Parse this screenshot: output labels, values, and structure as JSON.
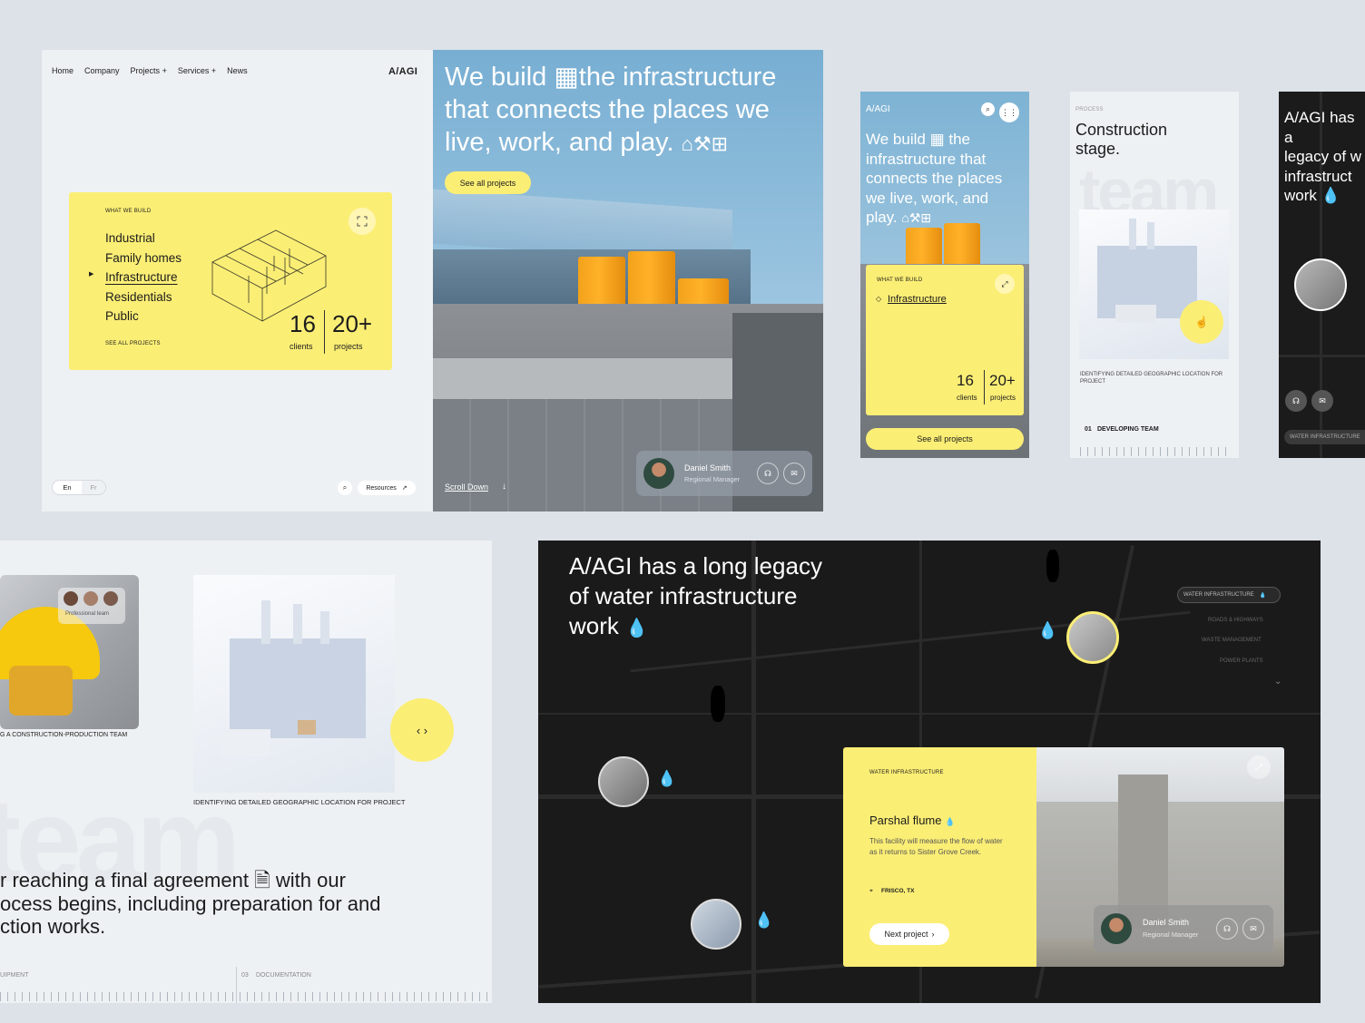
{
  "panelA": {
    "nav": [
      "Home",
      "Company",
      "Projects",
      "Services",
      "News"
    ],
    "plus_icon": "plus-icon",
    "logo": "A/AGI",
    "card": {
      "eyebrow": "WHAT WE BUILD",
      "items": [
        "Industrial",
        "Family homes",
        "Infrastructure",
        "Residentials",
        "Public"
      ],
      "active": "Infrastructure",
      "see_all": "SEE ALL PROJECTS",
      "stats": [
        {
          "value": "16",
          "label": "clients"
        },
        {
          "value": "20+",
          "label": "projects"
        }
      ]
    },
    "lang": [
      "En",
      "Fr"
    ],
    "resources": "Resources"
  },
  "panelB": {
    "hero_l1": "We build",
    "hero_l1b": "the infrastructure",
    "hero_l2": "that connects the places we",
    "hero_l3": "live, work, and play.",
    "cta": "See all projects",
    "scroll": "Scroll Down",
    "contact": {
      "name": "Daniel Smith",
      "role": "Regional Manager"
    }
  },
  "mobile1": {
    "logo": "A/AGI",
    "hero_a": "We build",
    "hero_b": "the",
    "hero_c": "infrastructure that",
    "hero_d": "connects the places",
    "hero_e": "we live, work, and",
    "hero_f": "play.",
    "eyebrow": "WHAT WE BUILD",
    "item": "Infrastructure",
    "stats": [
      {
        "value": "16",
        "label": "clients"
      },
      {
        "value": "20+",
        "label": "projects"
      }
    ],
    "cta": "See all projects"
  },
  "mobile2": {
    "eyebrow": "PROCESS",
    "title_1": "Construction",
    "title_2": "stage.",
    "bg_word": "team",
    "caption": "IDENTIFYING DETAILED GEOGRAPHIC LOCATION FOR PROJECT",
    "step_no": "01",
    "step": "DEVELOPING TEAM"
  },
  "mobile3": {
    "h1": "A/AGI has a",
    "h2": "legacy of w",
    "h3": "infrastruct",
    "h4": "work",
    "tag": "WATER INFRASTRUCTURE"
  },
  "panelF": {
    "team_badge": "Professional team",
    "caption_left": "G A CONSTRUCTION-PRODUCTION TEAM",
    "caption_right": "IDENTIFYING DETAILED  GEOGRAPHIC LOCATION FOR  PROJECT",
    "bg_word": "team",
    "para_1a": "r reaching a final agreement",
    "para_1b": "with our",
    "para_2": "ocess begins, including preparation for and",
    "para_3": "ction works.",
    "step_a": "UIPMENT",
    "step_b_no": "03",
    "step_b": "DOCUMENTATION"
  },
  "panelG": {
    "h1": "A/AGI has a long legacy",
    "h2": "of water infrastructure",
    "h3": "work",
    "filters": [
      "WATER INFRASTRUCTURE",
      "ROADS & HIGHWAYS",
      "WASTE MANAGEMENT",
      "POWER PLANTS"
    ],
    "card": {
      "eyebrow": "WATER INFRASTRUCTURE",
      "title": "Parshal flume",
      "desc": "This facility will measure the flow of water as it returns to Sister Grove Creek.",
      "location": "FRISCO, TX",
      "next": "Next project"
    },
    "contact": {
      "name": "Daniel Smith",
      "role": "Regional Manager"
    }
  },
  "colors": {
    "yellow": "#fbee75",
    "dark": "#1a1a1a",
    "sky": "#7eb3d4",
    "bg": "#dde2e8",
    "orange": "#f7a823"
  }
}
